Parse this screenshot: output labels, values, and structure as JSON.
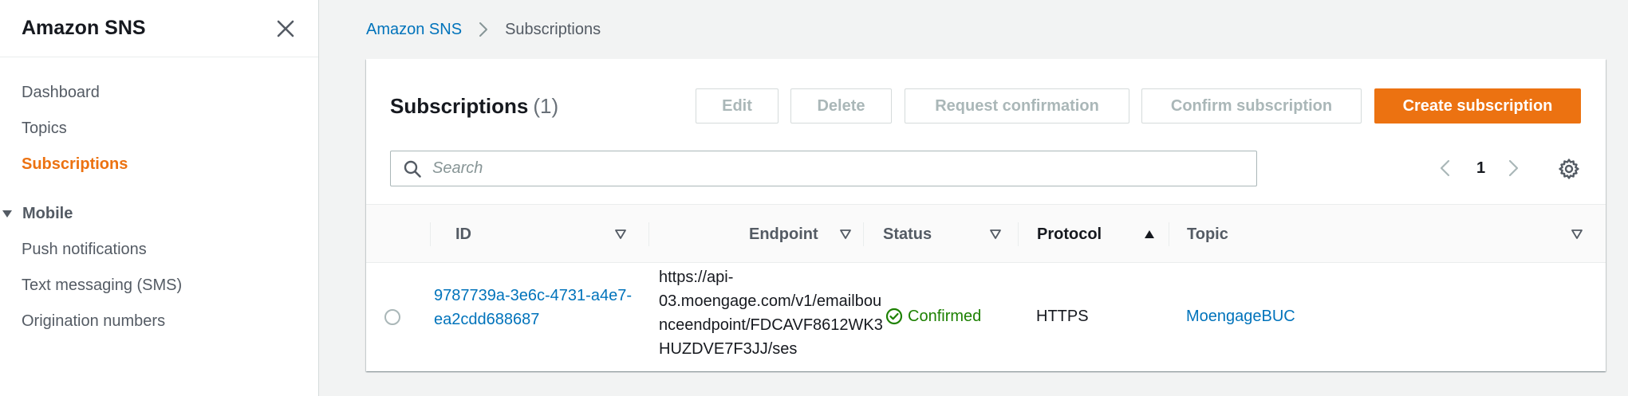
{
  "sidebar": {
    "title": "Amazon SNS",
    "items": [
      {
        "label": "Dashboard"
      },
      {
        "label": "Topics"
      },
      {
        "label": "Subscriptions"
      }
    ],
    "section": {
      "label": "Mobile",
      "items": [
        {
          "label": "Push notifications"
        },
        {
          "label": "Text messaging (SMS)"
        },
        {
          "label": "Origination numbers"
        }
      ]
    }
  },
  "breadcrumb": {
    "root": "Amazon SNS",
    "current": "Subscriptions"
  },
  "panel": {
    "title": "Subscriptions",
    "count": "(1)",
    "buttons": {
      "edit": "Edit",
      "delete": "Delete",
      "request_confirmation": "Request confirmation",
      "confirm_subscription": "Confirm subscription",
      "create_subscription": "Create subscription"
    },
    "search_placeholder": "Search",
    "page_number": "1"
  },
  "table": {
    "columns": [
      "ID",
      "Endpoint",
      "Status",
      "Protocol",
      "Topic"
    ],
    "rows": [
      {
        "id_lines": [
          "9787739a-3e6c-4731-a4e7-",
          "ea2cdd688687"
        ],
        "endpoint_lines": [
          "https://api-",
          "03.moengage.com/v1/emailbou",
          "nceendpoint/FDCAVF8612WK3",
          "HUZDVE7F3JJ/ses"
        ],
        "status": "Confirmed",
        "protocol": "HTTPS",
        "topic": "MoengageBUC"
      }
    ]
  },
  "colors": {
    "accent": "#ec7211",
    "link": "#0073bb",
    "success": "#1d8102",
    "disabled_text": "#aab7b8"
  },
  "icons": {
    "close": "close-icon",
    "caret": "caret-down-icon",
    "chevron": "chevron-right-icon",
    "search": "search-icon",
    "prev": "chevron-left-icon",
    "next": "chevron-right-icon",
    "settings": "gear-icon",
    "sort_desc": "sort-caret-down-icon",
    "sort_asc": "sort-caret-up-icon",
    "status_ok": "check-circle-icon"
  }
}
